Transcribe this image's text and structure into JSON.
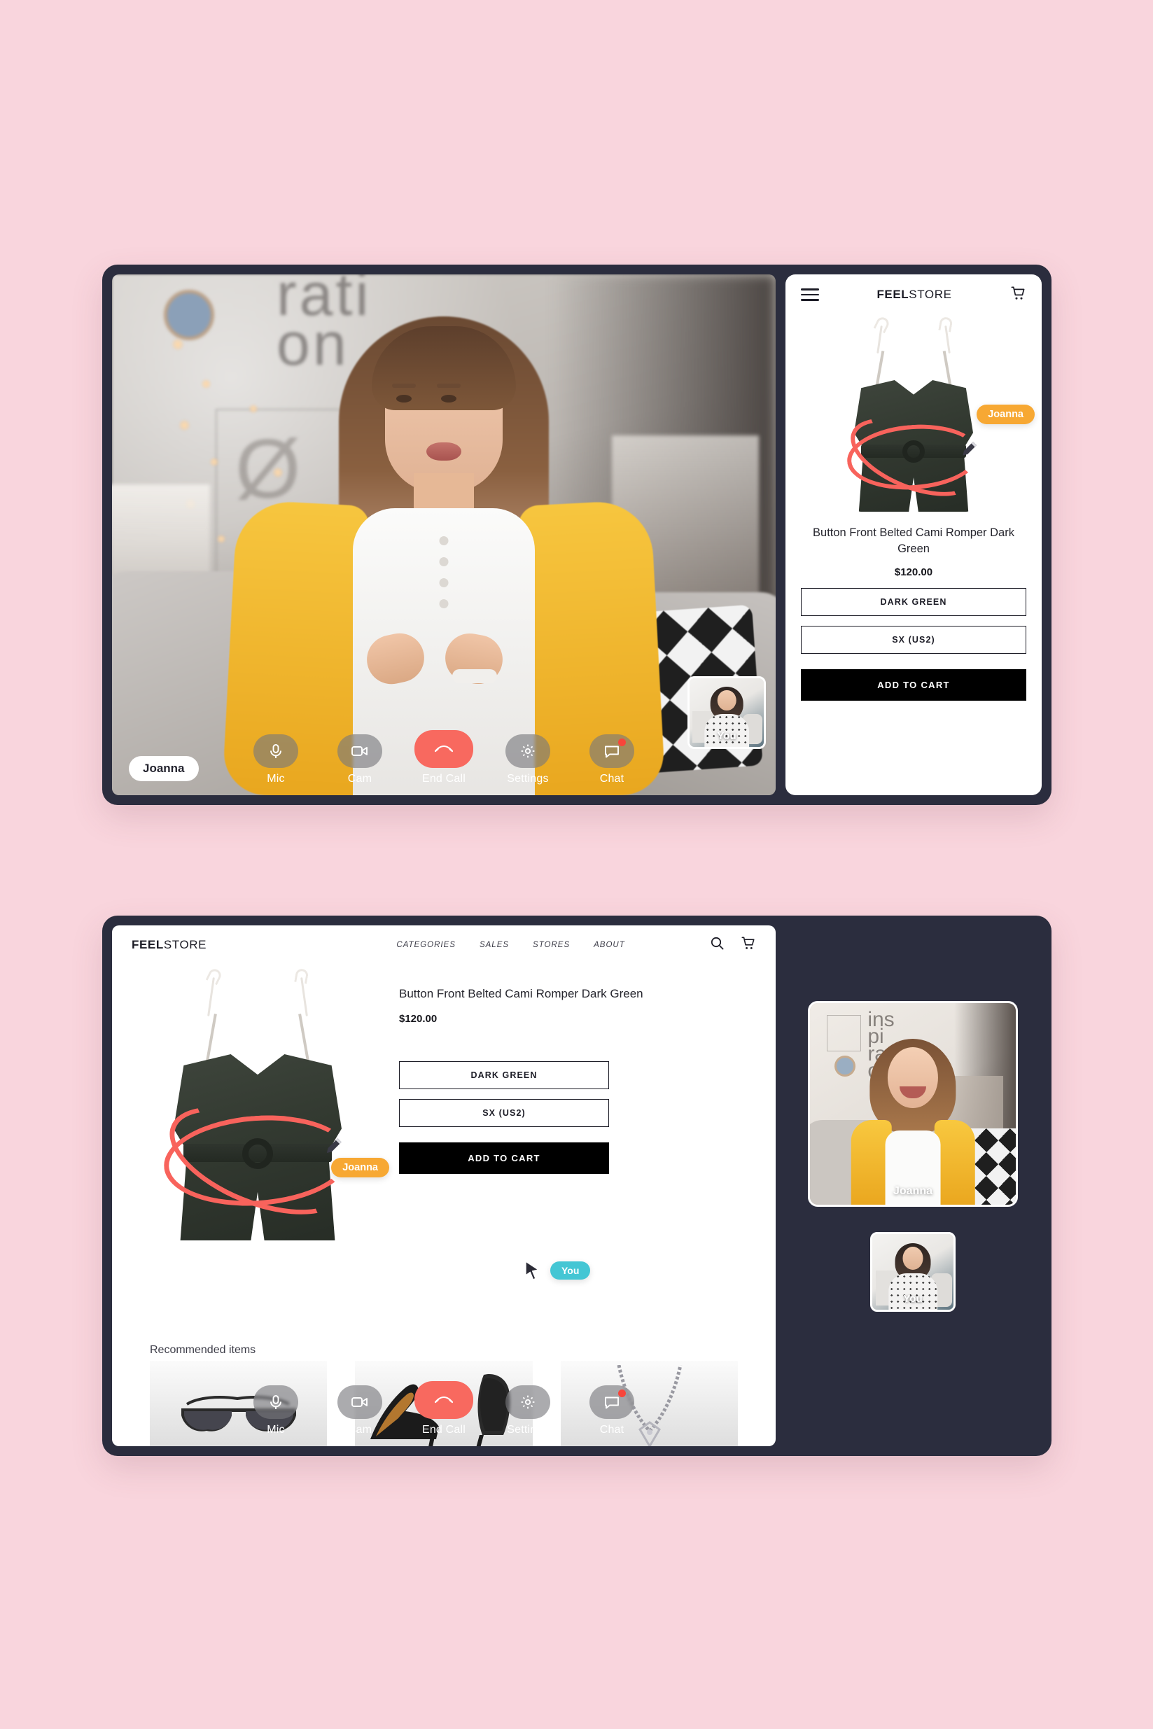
{
  "brand": {
    "bold": "FEEL",
    "light": "STORE"
  },
  "product": {
    "title": "Button Front Belted Cami Romper Dark Green",
    "price": "$120.00",
    "color_option": "DARK GREEN",
    "size_option": "SX (US2)",
    "add_to_cart": "ADD TO CART"
  },
  "web_nav": [
    {
      "label": "CATEGORIES"
    },
    {
      "label": "SALES"
    },
    {
      "label": "STORES"
    },
    {
      "label": "ABOUT"
    }
  ],
  "controls": [
    {
      "label": "Mic",
      "icon": "microphone-icon"
    },
    {
      "label": "Cam",
      "icon": "video-camera-icon"
    },
    {
      "label": "End Call",
      "icon": "end-call-icon"
    },
    {
      "label": "Settings",
      "icon": "gear-icon"
    },
    {
      "label": "Chat",
      "icon": "chat-bubble-icon"
    }
  ],
  "participants": {
    "host_name": "Joanna",
    "self_name": "You"
  },
  "annotation": {
    "author_tag": "Joanna",
    "cursor_tag": "You",
    "circle_color": "#f8635c",
    "host_tag_color": "#f7a833",
    "self_tag_color": "#44c6d4"
  },
  "recommended": {
    "heading": "Recommended items",
    "items": [
      {
        "name": "sunglasses"
      },
      {
        "name": "high-heel-shoes"
      },
      {
        "name": "necklace"
      }
    ]
  },
  "colors": {
    "page_background": "#f9d5dd",
    "device_frame": "#2b2d3e",
    "accent_red": "#f8695f",
    "text_dark": "#1c1c26"
  }
}
